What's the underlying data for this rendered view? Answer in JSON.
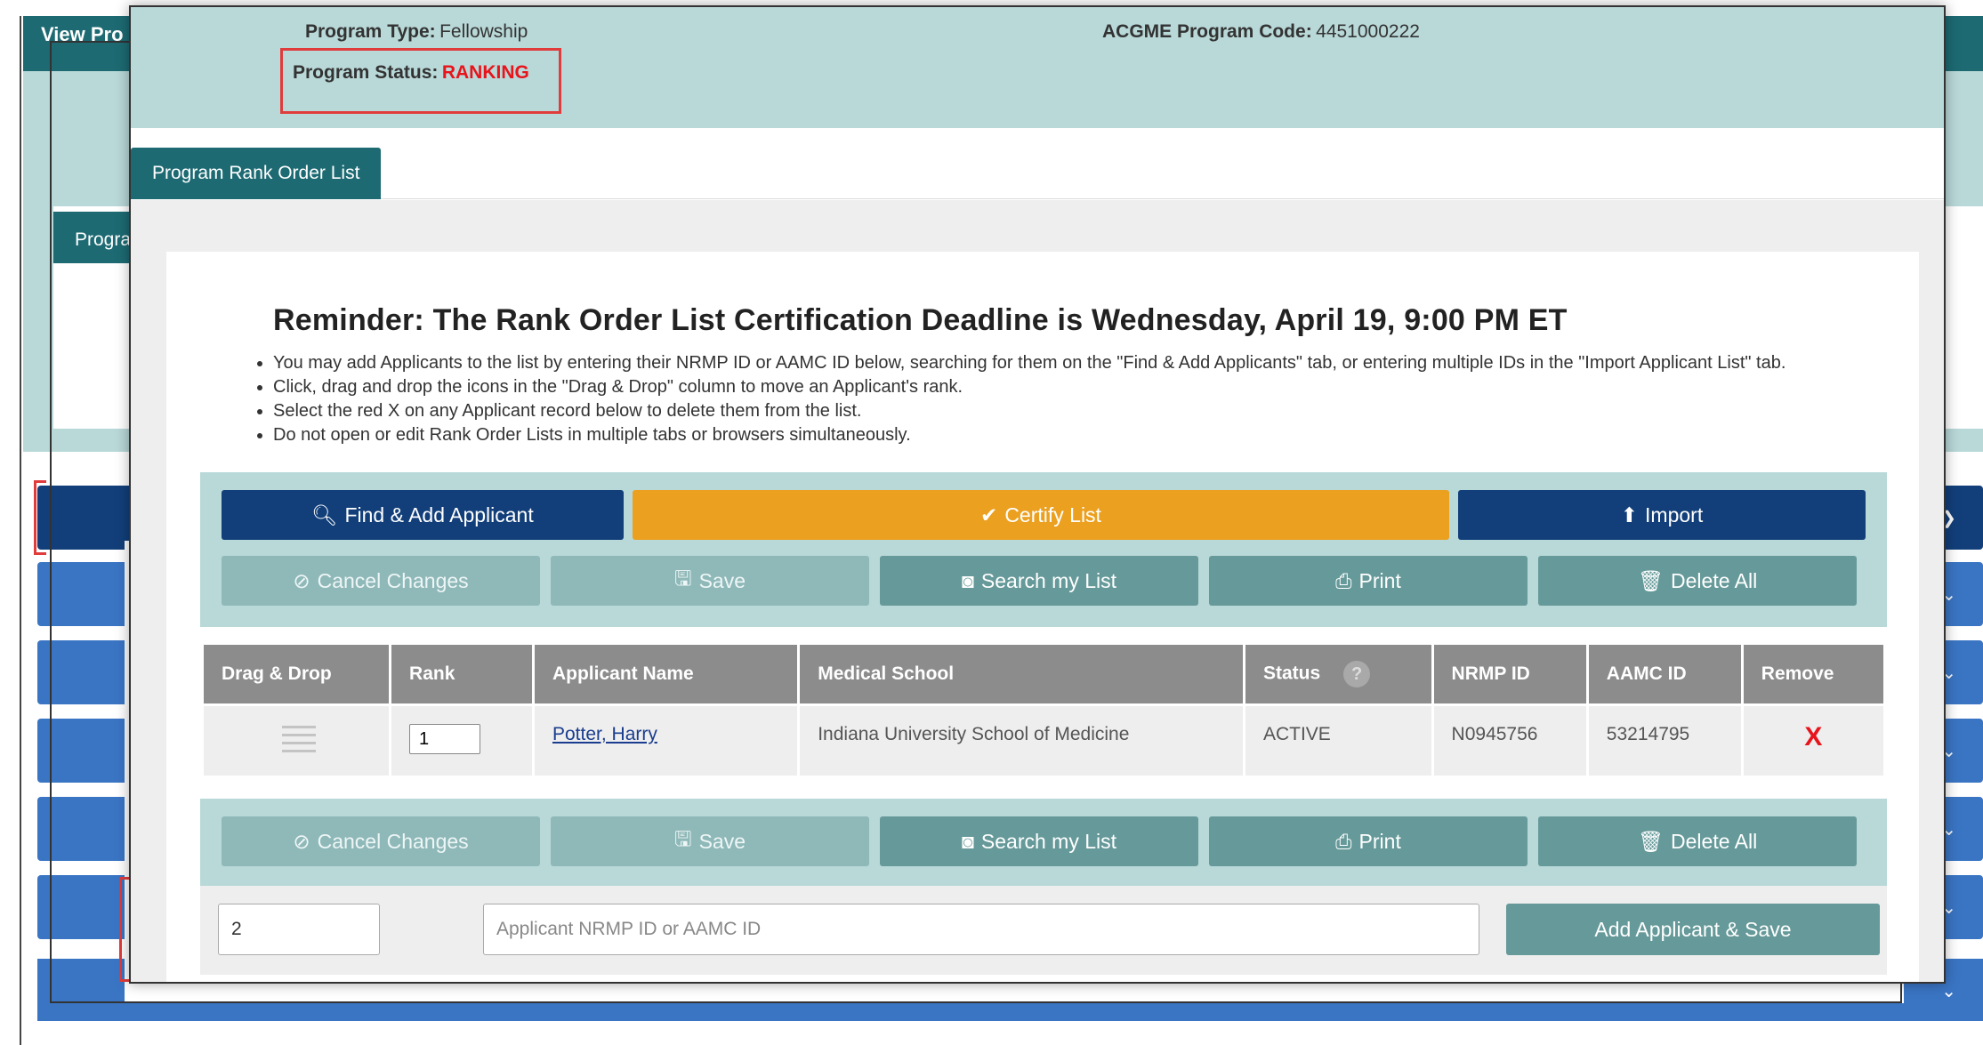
{
  "background": {
    "header_text": "View Pro",
    "tab_label": "Progra"
  },
  "program": {
    "type_label": "Program Type:",
    "type_value": "Fellowship",
    "status_label": "Program Status:",
    "status_value": "RANKING",
    "code_label": "ACGME Program Code:",
    "code_value": "4451000222"
  },
  "tabs": [
    {
      "label": "Program Rank Order List",
      "active": true
    }
  ],
  "reminder": {
    "title": "Reminder: The Rank Order List Certification Deadline is Wednesday, April 19, 9:00 PM ET",
    "notes": [
      "You may add Applicants to the list by entering their NRMP ID or AAMC ID below, searching for them on the \"Find & Add Applicants\" tab, or entering multiple IDs in the \"Import Applicant List\" tab.",
      "Click, drag and drop the icons in the \"Drag & Drop\" column to move an Applicant's rank.",
      "Select the red X on any Applicant record below to delete them from the list.",
      "Do not open or edit Rank Order Lists in multiple tabs or browsers simultaneously."
    ]
  },
  "actions": {
    "find_add": "Find & Add Applicant",
    "certify": "Certify List",
    "import": "Import",
    "cancel_changes": "Cancel Changes",
    "save": "Save",
    "search_list": "Search my List",
    "print": "Print",
    "delete_all": "Delete All"
  },
  "table": {
    "headers": [
      "Drag & Drop",
      "Rank",
      "Applicant Name",
      "Medical School",
      "Status",
      "NRMP ID",
      "AAMC ID",
      "Remove"
    ],
    "rows": [
      {
        "rank": "1",
        "name": "Potter, Harry",
        "school": "Indiana University School of Medicine",
        "status": "ACTIVE",
        "nrmp_id": "N0945756",
        "aamc_id": "53214795",
        "remove": "X"
      }
    ]
  },
  "add_form": {
    "next_rank": "2",
    "id_placeholder": "Applicant NRMP ID or AAMC ID",
    "submit_label": "Add Applicant & Save"
  },
  "colors": {
    "navy": "#123f7a",
    "orange": "#eba020",
    "teal": "#669999",
    "status_red": "#e8141b",
    "header_teal": "#1d6a73",
    "light_teal": "#b9d8d8"
  }
}
